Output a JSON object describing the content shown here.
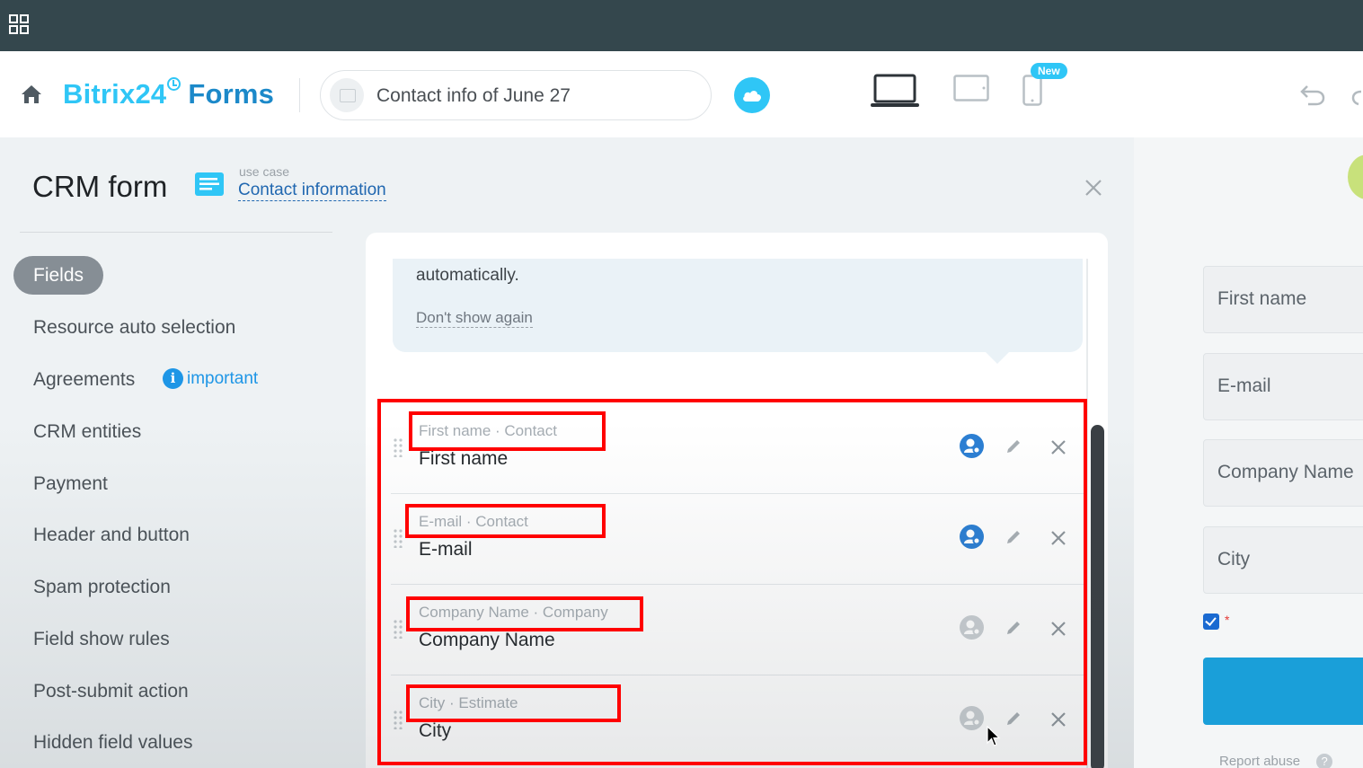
{
  "header": {
    "brand_primary": "Bitrix24",
    "brand_secondary": "Forms",
    "form_title": "Contact info of June 27",
    "new_badge": "New"
  },
  "panel": {
    "title": "CRM form",
    "use_case_label": "use case",
    "use_case_value": "Contact information"
  },
  "nav": {
    "active": "Fields",
    "items": [
      "Resource auto selection",
      "Agreements",
      "CRM entities",
      "Payment",
      "Header and button",
      "Spam protection",
      "Field show rules",
      "Post-submit action",
      "Hidden field values"
    ],
    "important_label": "important"
  },
  "hint": {
    "text": "automatically.",
    "dismiss": "Don't show again"
  },
  "fields": [
    {
      "sub": "First name · Contact",
      "name": "First name",
      "linked": true
    },
    {
      "sub": "E-mail · Contact",
      "name": "E-mail",
      "linked": true
    },
    {
      "sub": "Company Name · Company",
      "name": "Company Name",
      "linked": false
    },
    {
      "sub": "City · Estimate",
      "name": "City",
      "linked": false
    }
  ],
  "preview": {
    "fields": [
      "First name",
      "E-mail",
      "Company Name",
      "City"
    ],
    "required_mark": "*",
    "report_abuse": "Report abuse",
    "help": "?"
  },
  "colors": {
    "accent": "#2fc6f6",
    "brand_dark": "#1c89c9",
    "link": "#2067b0",
    "highlight": "#ff0000",
    "topbar": "#34474d"
  }
}
